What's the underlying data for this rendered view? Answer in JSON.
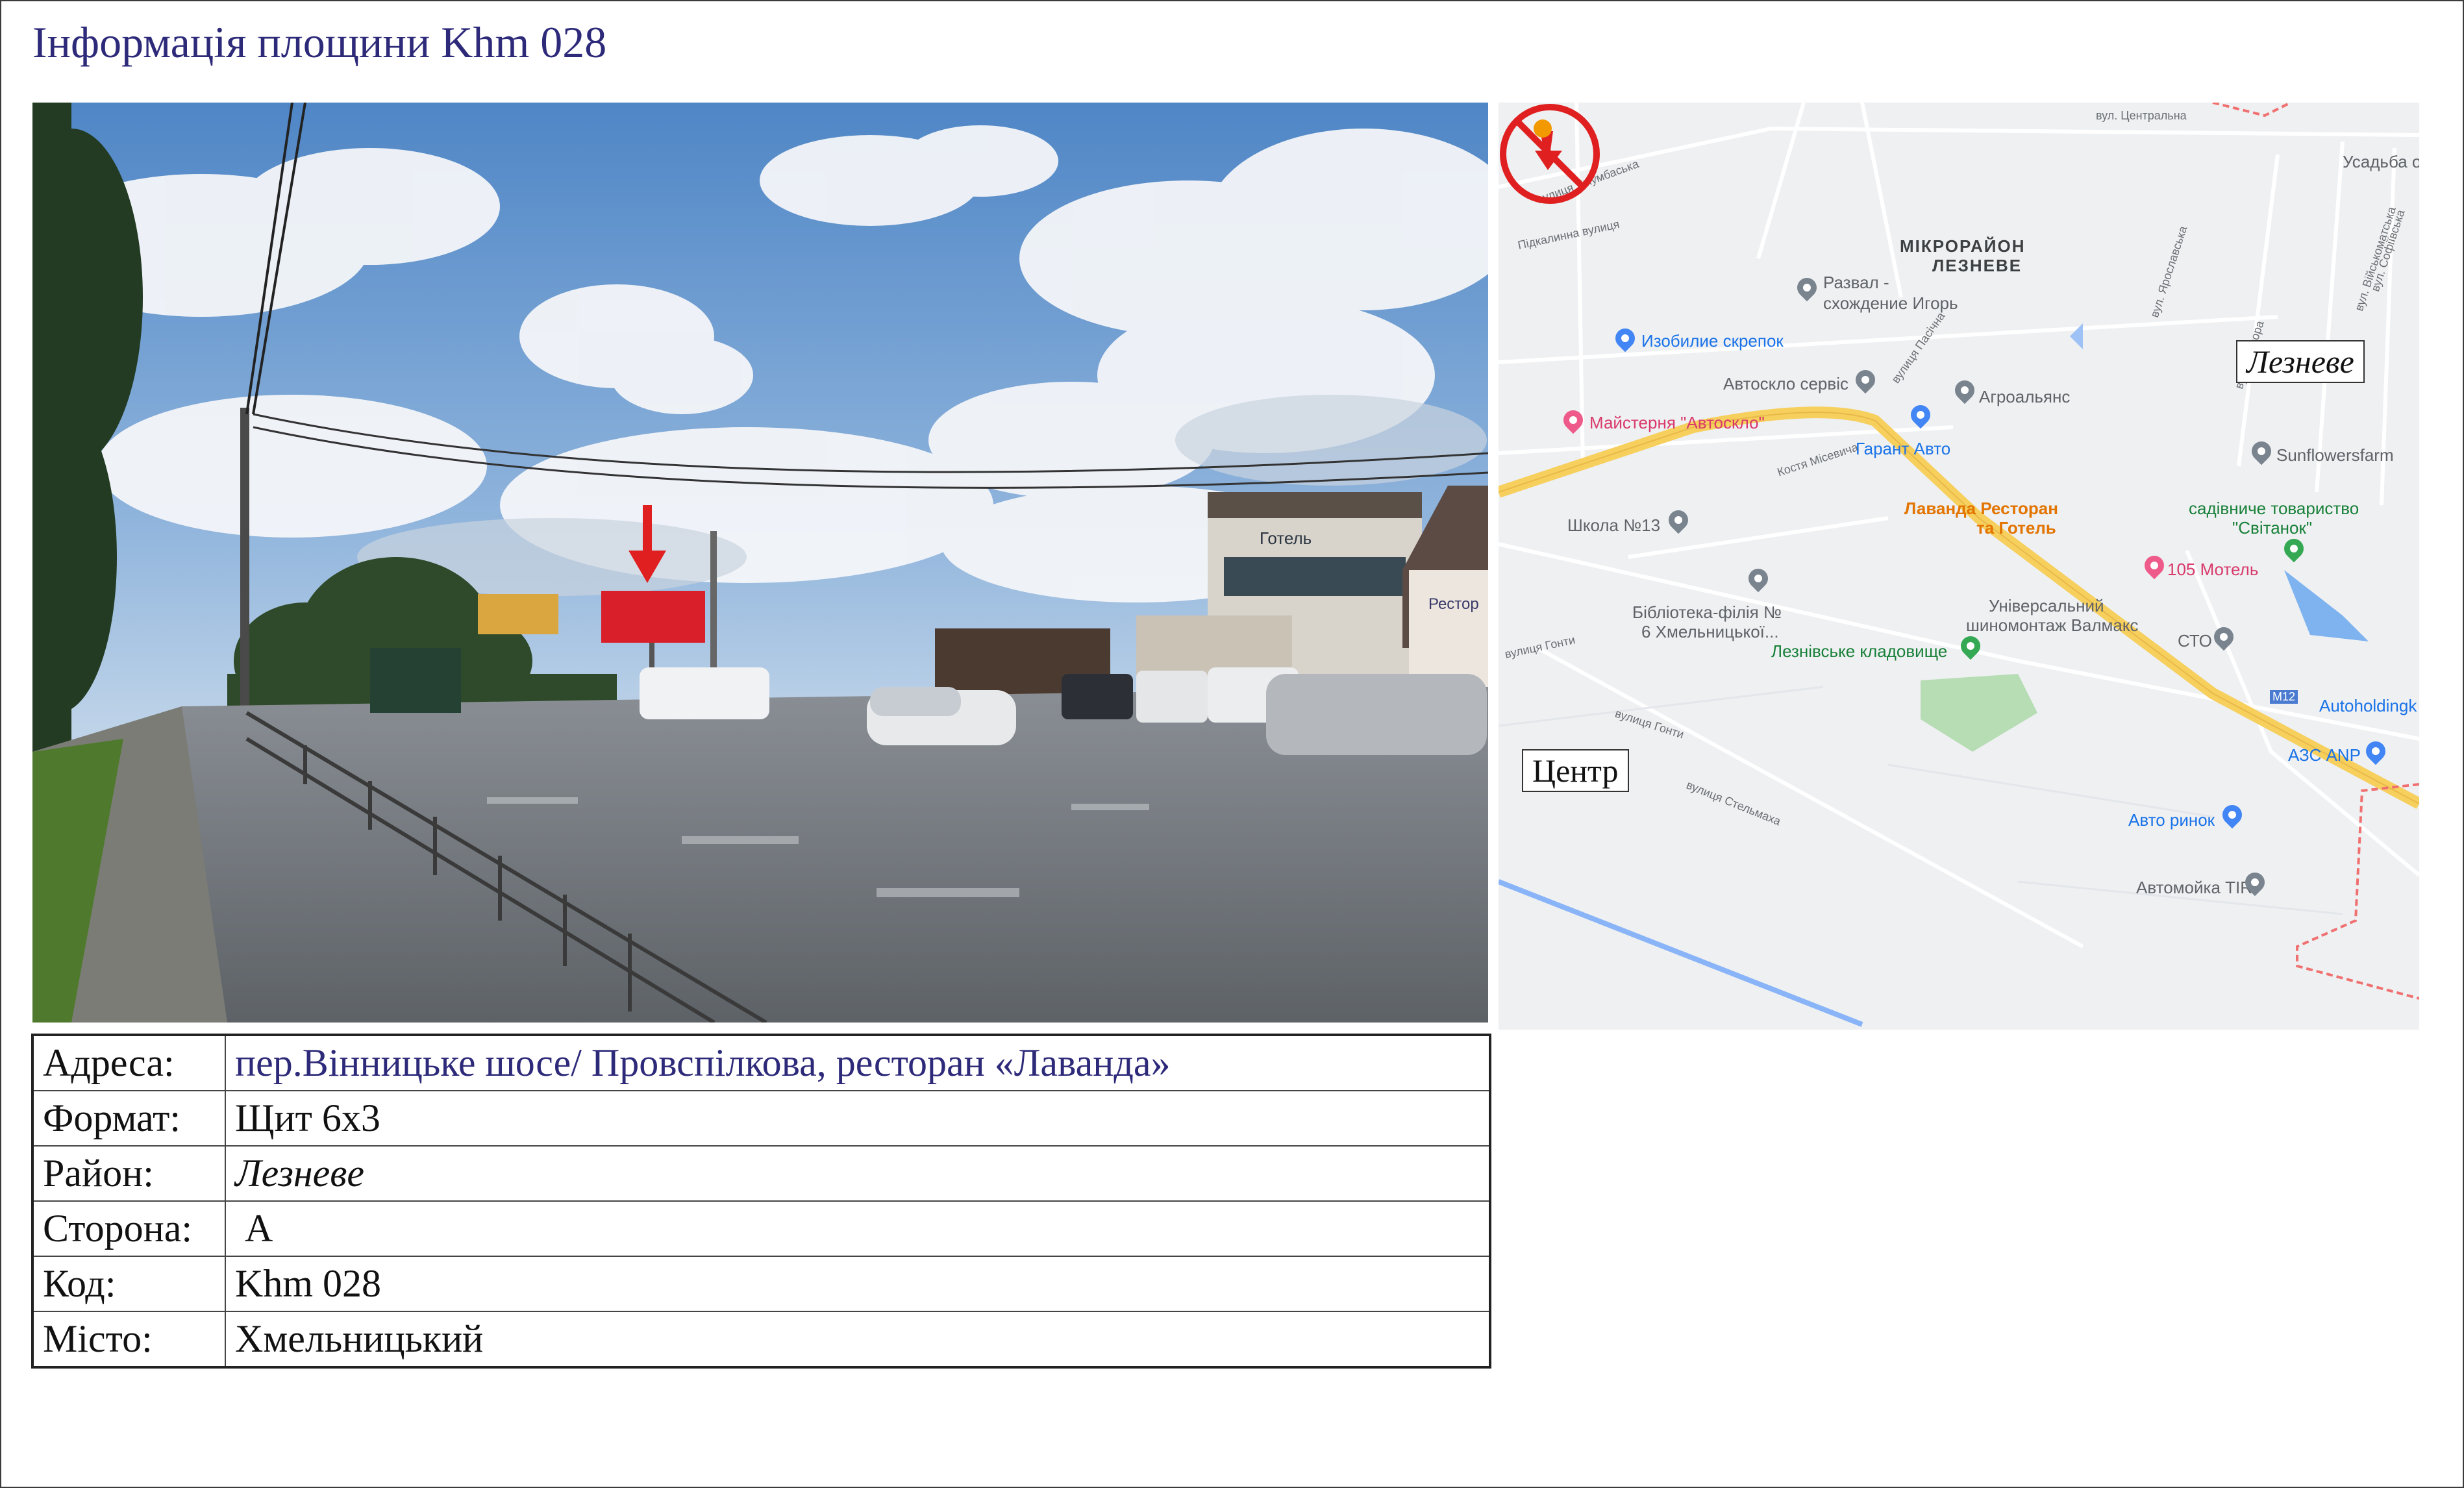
{
  "page": {
    "title": "Інформація площини Khm 028"
  },
  "map": {
    "labels": {
      "north": "Лезневе",
      "center": "Центр"
    },
    "district": [
      "МІКРОРАЙОН",
      "ЛЕЗНЕВЕ"
    ],
    "pois": [
      {
        "text": "Развал -",
        "kind": "grey"
      },
      {
        "text": "схождение Игорь",
        "kind": "grey"
      },
      {
        "text": "Изобилие скрепок",
        "kind": "blue"
      },
      {
        "text": "Автоскло сервіс",
        "kind": "grey"
      },
      {
        "text": "Агроальянс",
        "kind": "grey"
      },
      {
        "text": "Майстерня \"Автоскло\"",
        "kind": "pink"
      },
      {
        "text": "Гарант Авто",
        "kind": "blue"
      },
      {
        "text": "Sunflowersfarm",
        "kind": "grey"
      },
      {
        "text": "Лаванда Ресторан",
        "kind": "orange"
      },
      {
        "text": "та Готель",
        "kind": "orange"
      },
      {
        "text": "садівниче товариство",
        "kind": "green"
      },
      {
        "text": "\"Світанок\"",
        "kind": "green"
      },
      {
        "text": "Школа №13",
        "kind": "grey"
      },
      {
        "text": "105 Мотель",
        "kind": "pink"
      },
      {
        "text": "Бібліотека-філія №",
        "kind": "grey"
      },
      {
        "text": "6 Хмельницької...",
        "kind": "grey"
      },
      {
        "text": "Універсальний",
        "kind": "grey"
      },
      {
        "text": "шиномонтаж Валмакс",
        "kind": "grey"
      },
      {
        "text": "СТО",
        "kind": "grey"
      },
      {
        "text": "Лезнівське кладовище",
        "kind": "green"
      },
      {
        "text": "Autoholdingk",
        "kind": "blue"
      },
      {
        "text": "АЗС ANP",
        "kind": "blue"
      },
      {
        "text": "Авто ринок",
        "kind": "blue"
      },
      {
        "text": "Автомойка TIR",
        "kind": "grey"
      },
      {
        "text": "Усадьба о",
        "kind": "grey"
      }
    ],
    "streets": [
      "вул. Центральна",
      "вулиця Джумбаська",
      "Підкалинна вулиця",
      "вулиця Гонти",
      "вулиця Гонти",
      "вулиця Стельмаха",
      "Костя Місевича",
      "вул. Ярославська",
      "вул. Прозора",
      "вул. Військоматська",
      "вул. Софіївська",
      "M12",
      "вулиця Пасічна"
    ]
  },
  "details": {
    "rows": [
      {
        "label": "Адреса:",
        "value": "пер.Вінницьке шосе/ Провспілкова, ресторан «Лаванда»"
      },
      {
        "label": "Формат:",
        "value": "Щит 6х3"
      },
      {
        "label": "Район:",
        "value": "Лезневе"
      },
      {
        "label": "Сторона:",
        "value": " А"
      },
      {
        "label": "Код:",
        "value": "Khm 028"
      },
      {
        "label": "Місто:",
        "value": "Хмельницький"
      }
    ]
  },
  "photo": {
    "signs": {
      "hotel": "Готель",
      "restaurant": "Рестор"
    }
  },
  "colors": {
    "title": "#2e2a7a",
    "arrow": "#e02020",
    "billboard": "#d81f2a",
    "highway": "#f6cf5c",
    "marker": "#e02020"
  }
}
